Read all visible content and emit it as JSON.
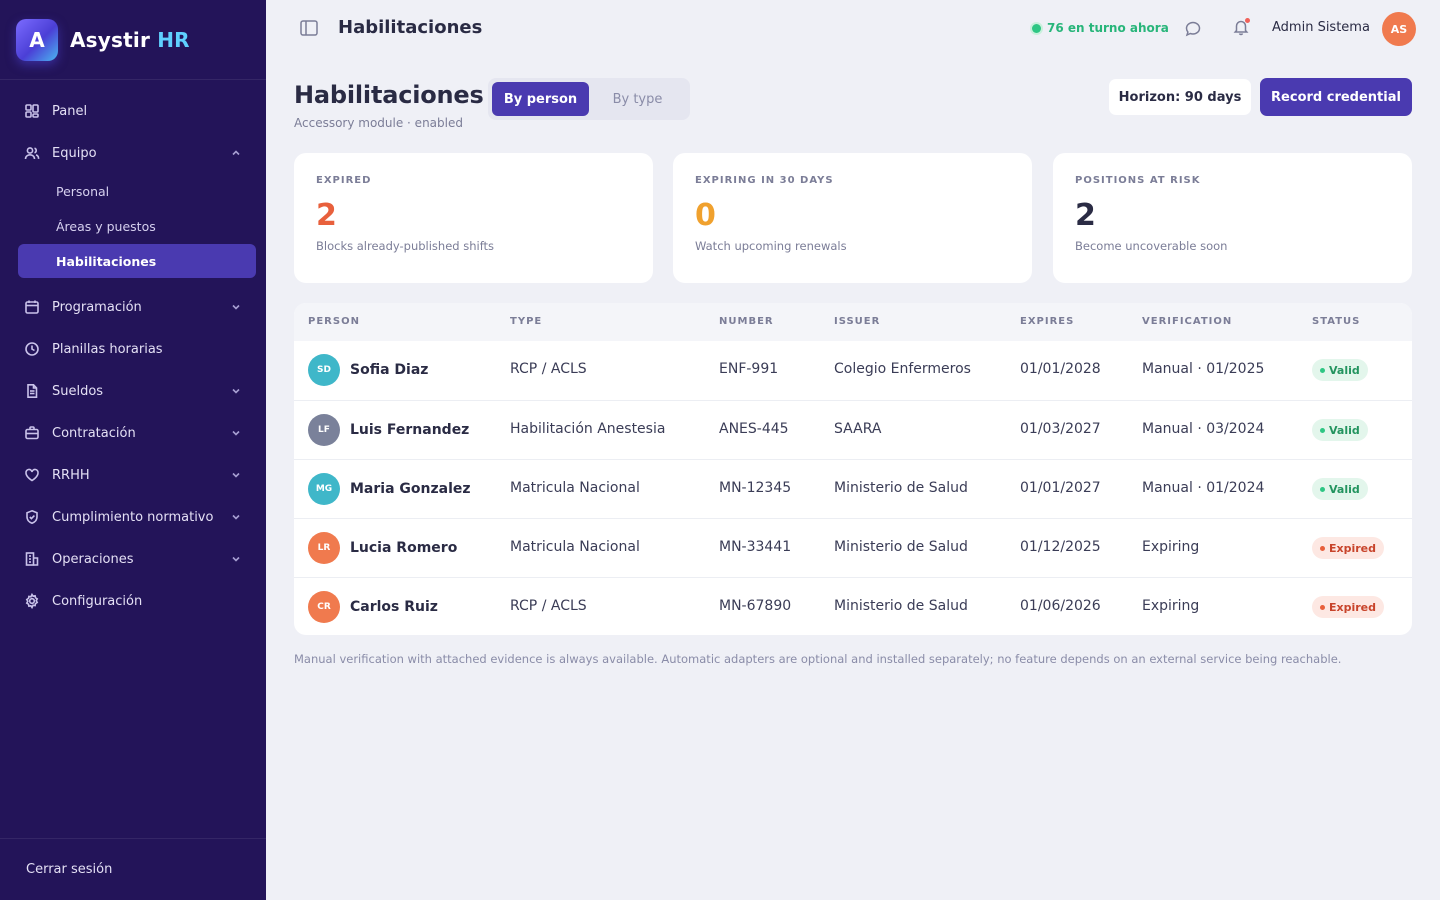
{
  "brand": {
    "logo_letter": "A",
    "name": "Asystir",
    "accent": "HR"
  },
  "sidebar": {
    "items": [
      {
        "label": "Panel",
        "icon": "grid-icon",
        "expandable": false
      },
      {
        "label": "Equipo",
        "icon": "users-icon",
        "expandable": true,
        "expanded": true,
        "children": [
          {
            "label": "Personal",
            "active": false
          },
          {
            "label": "Áreas y puestos",
            "active": false
          },
          {
            "label": "Habilitaciones",
            "active": true
          }
        ]
      },
      {
        "label": "Programación",
        "icon": "calendar-icon",
        "expandable": true
      },
      {
        "label": "Planillas horarias",
        "icon": "clock-icon",
        "expandable": false
      },
      {
        "label": "Sueldos",
        "icon": "document-icon",
        "expandable": true
      },
      {
        "label": "Contratación",
        "icon": "briefcase-icon",
        "expandable": true
      },
      {
        "label": "RRHH",
        "icon": "heart-icon",
        "expandable": true
      },
      {
        "label": "Cumplimiento normativo",
        "icon": "shield-icon",
        "expandable": true
      },
      {
        "label": "Operaciones",
        "icon": "building-icon",
        "expandable": true
      },
      {
        "label": "Configuración",
        "icon": "gear-icon",
        "expandable": false
      }
    ],
    "logout": "Cerrar sesión"
  },
  "topbar": {
    "title": "Habilitaciones",
    "online": "76 en turno ahora",
    "user_name": "Admin Sistema",
    "user_initials": "AS"
  },
  "page": {
    "title": "Habilitaciones",
    "subtitle": "Accessory module · enabled",
    "tabs": [
      {
        "label": "By person",
        "active": true
      },
      {
        "label": "By type",
        "active": false
      }
    ],
    "horizon": "Horizon: 90 days",
    "record": "Record credential"
  },
  "cards": [
    {
      "label": "EXPIRED",
      "value": "2",
      "desc": "Blocks already-published shifts",
      "color": "#e8603c"
    },
    {
      "label": "EXPIRING IN 30 DAYS",
      "value": "0",
      "desc": "Watch upcoming renewals",
      "color": "#f0a12e"
    },
    {
      "label": "POSITIONS AT RISK",
      "value": "2",
      "desc": "Become uncoverable soon",
      "color": "#2a2b44"
    }
  ],
  "table": {
    "columns": [
      "PERSON",
      "TYPE",
      "NUMBER",
      "ISSUER",
      "EXPIRES",
      "VERIFICATION",
      "STATUS"
    ],
    "rows": [
      {
        "initials": "SD",
        "name": "Sofia Diaz",
        "type": "RCP / ACLS",
        "number": "ENF-991",
        "issuer": "Colegio Enfermeros",
        "expires": "01/01/2028",
        "verification": "Manual · 01/2025",
        "status": "Valid",
        "avatar_color": "#3fb7c9"
      },
      {
        "initials": "LF",
        "name": "Luis Fernandez",
        "type": "Habilitación Anestesia",
        "number": "ANES-445",
        "issuer": "SAARA",
        "expires": "01/03/2027",
        "verification": "Manual · 03/2024",
        "status": "Valid",
        "avatar_color": "#7a819a"
      },
      {
        "initials": "MG",
        "name": "Maria Gonzalez",
        "type": "Matricula Nacional",
        "number": "MN-12345",
        "issuer": "Ministerio de Salud",
        "expires": "01/01/2027",
        "verification": "Manual · 01/2024",
        "status": "Valid",
        "avatar_color": "#3fb7c9"
      },
      {
        "initials": "LR",
        "name": "Lucia Romero",
        "type": "Matricula Nacional",
        "number": "MN-33441",
        "issuer": "Ministerio de Salud",
        "expires": "01/12/2025",
        "verification": "Expiring",
        "status": "Expired",
        "avatar_color": "#f07a4e"
      },
      {
        "initials": "CR",
        "name": "Carlos Ruiz",
        "type": "RCP / ACLS",
        "number": "MN-67890",
        "issuer": "Ministerio de Salud",
        "expires": "01/06/2026",
        "verification": "Expiring",
        "status": "Expired",
        "avatar_color": "#f07a4e"
      }
    ]
  },
  "status_colors": {
    "Valid": {
      "bg": "#e3f6ec",
      "fg": "#23945f",
      "dot": "#2ec684"
    },
    "Expired": {
      "bg": "#fde8e3",
      "fg": "#c8442b",
      "dot": "#e8603c"
    }
  },
  "footnote": "Manual verification with attached evidence is always available. Automatic adapters are optional and installed separately; no feature depends on an external service being reachable."
}
